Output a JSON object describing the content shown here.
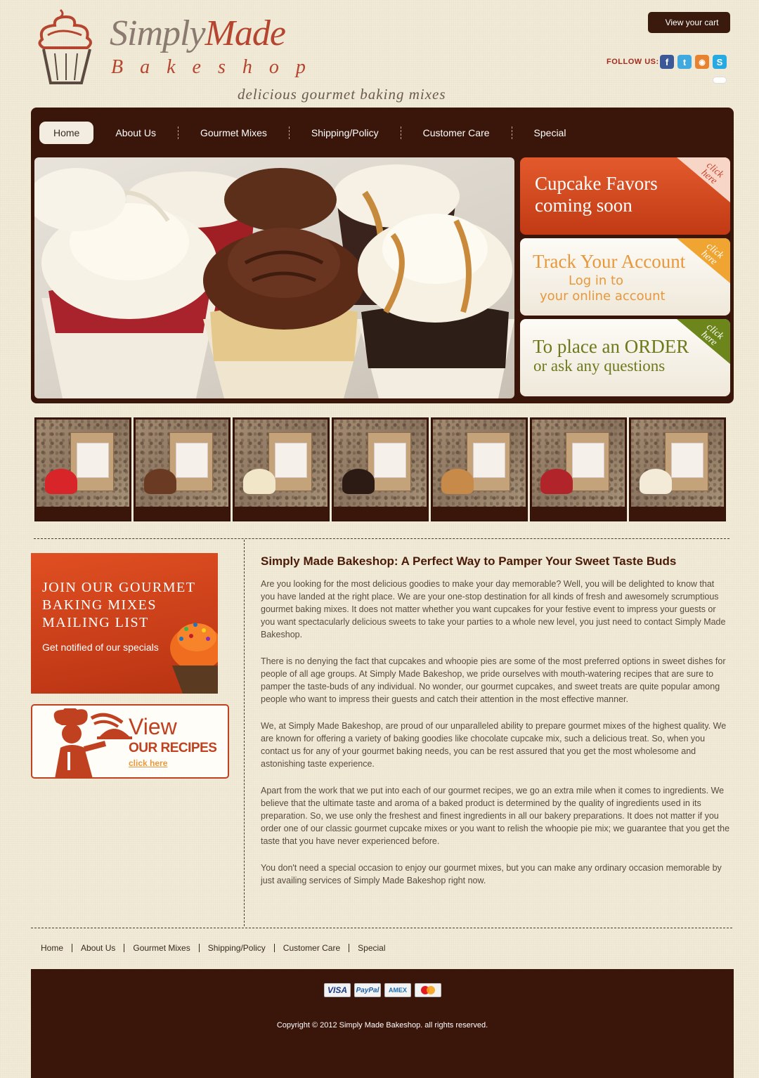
{
  "header": {
    "logo_word_1": "Simply",
    "logo_word_2": "Made",
    "logo_sub": "Bakeshop",
    "tagline": "delicious gourmet baking mixes",
    "cart_label": "View your cart",
    "follow_label": "FOLLOW US:",
    "social": [
      {
        "icon": "facebook-icon",
        "glyph": "f",
        "color": "#3b5998"
      },
      {
        "icon": "twitter-icon",
        "glyph": "t",
        "color": "#3fa9e0"
      },
      {
        "icon": "rss-icon",
        "glyph": "◉",
        "color": "#e9822e"
      },
      {
        "icon": "skype-icon",
        "glyph": "S",
        "color": "#27a9e1"
      }
    ]
  },
  "nav": {
    "items": [
      "Home",
      "About Us",
      "Gourmet Mixes",
      "Shipping/Policy",
      "Customer Care",
      "Special"
    ],
    "active": "Home"
  },
  "promos": {
    "favors": {
      "line1": "Cupcake Favors",
      "line2": "coming soon",
      "corner": "click here"
    },
    "account": {
      "title": "Track Your Account",
      "line2": "Log in to",
      "line3": "your online account",
      "corner": "click here"
    },
    "order": {
      "line1": "To place an ORDER",
      "line2": "or ask any questions",
      "corner": "click here"
    }
  },
  "thumbnails": [
    {
      "cake": "#d8252a",
      "name": "thumbnail-1"
    },
    {
      "cake": "#6b3a22",
      "name": "thumbnail-2"
    },
    {
      "cake": "#f1e6c8",
      "name": "thumbnail-3"
    },
    {
      "cake": "#2b1b14",
      "name": "thumbnail-4"
    },
    {
      "cake": "#c88a48",
      "name": "thumbnail-5"
    },
    {
      "cake": "#b1242a",
      "name": "thumbnail-6"
    },
    {
      "cake": "#f3ead8",
      "name": "thumbnail-7"
    }
  ],
  "sidebar": {
    "mailing_title_1": "JOIN OUR GOURMET",
    "mailing_title_2": "BAKING MIXES",
    "mailing_title_3": "MAILING LIST",
    "mailing_sub": "Get notified of our specials",
    "recipes_view": "View",
    "recipes_our": "OUR RECIPES",
    "recipes_click": "click here"
  },
  "article": {
    "title": "Simply Made Bakeshop: A Perfect Way to Pamper Your Sweet Taste Buds",
    "paragraphs": [
      "Are you looking for the most delicious goodies to make your day memorable? Well, you will be delighted to know that you have landed at the right place. We are your one-stop destination for all kinds of fresh and awesomely scrumptious gourmet baking mixes. It does not matter whether you want cupcakes for your festive event to impress your guests or you want spectacularly delicious sweets to take your parties to a whole new level, you just need to contact Simply Made Bakeshop.",
      "There is no denying the fact that cupcakes and whoopie pies are some of the most preferred options in sweet dishes for people of all age groups. At Simply Made Bakeshop, we pride ourselves with mouth-watering recipes that are sure to pamper the taste-buds of any individual. No wonder, our gourmet cupcakes, and sweet treats are quite popular among people who want to impress their guests and catch their attention in the most effective manner.",
      "We, at Simply Made Bakeshop, are proud of our unparalleled ability to prepare gourmet mixes of the highest quality. We are known for offering a variety of baking goodies like chocolate cupcake mix, such a delicious treat. So, when you contact us for any of your gourmet baking needs, you can be rest assured that you get the most wholesome and astonishing taste experience.",
      "Apart from the work that we put into each of our gourmet recipes, we go an extra mile when it comes to ingredients. We believe that the ultimate taste and aroma of a baked product is determined by the quality of ingredients used in its preparation. So, we use only the freshest and finest ingredients in all our bakery preparations. It does not matter if you order one of our classic gourmet cupcake mixes or you want to relish the whoopie pie mix; we guarantee that you get the taste that you have never experienced before.",
      "You don't need a special occasion to enjoy our gourmet mixes, but you can make any ordinary occasion memorable by just availing services of Simply Made Bakeshop right now."
    ]
  },
  "footer": {
    "nav": [
      "Home",
      "About Us",
      "Gourmet Mixes",
      "Shipping/Policy",
      "Customer Care",
      "Special"
    ],
    "payments": [
      "VISA",
      "PayPal",
      "AMEX",
      "MasterCard"
    ],
    "copyright": "Copyright © 2012 Simply Made Bakeshop. all rights reserved."
  },
  "colors": {
    "brand_dark": "#3a1509",
    "accent": "#c0411f",
    "background": "#f1ead6"
  }
}
